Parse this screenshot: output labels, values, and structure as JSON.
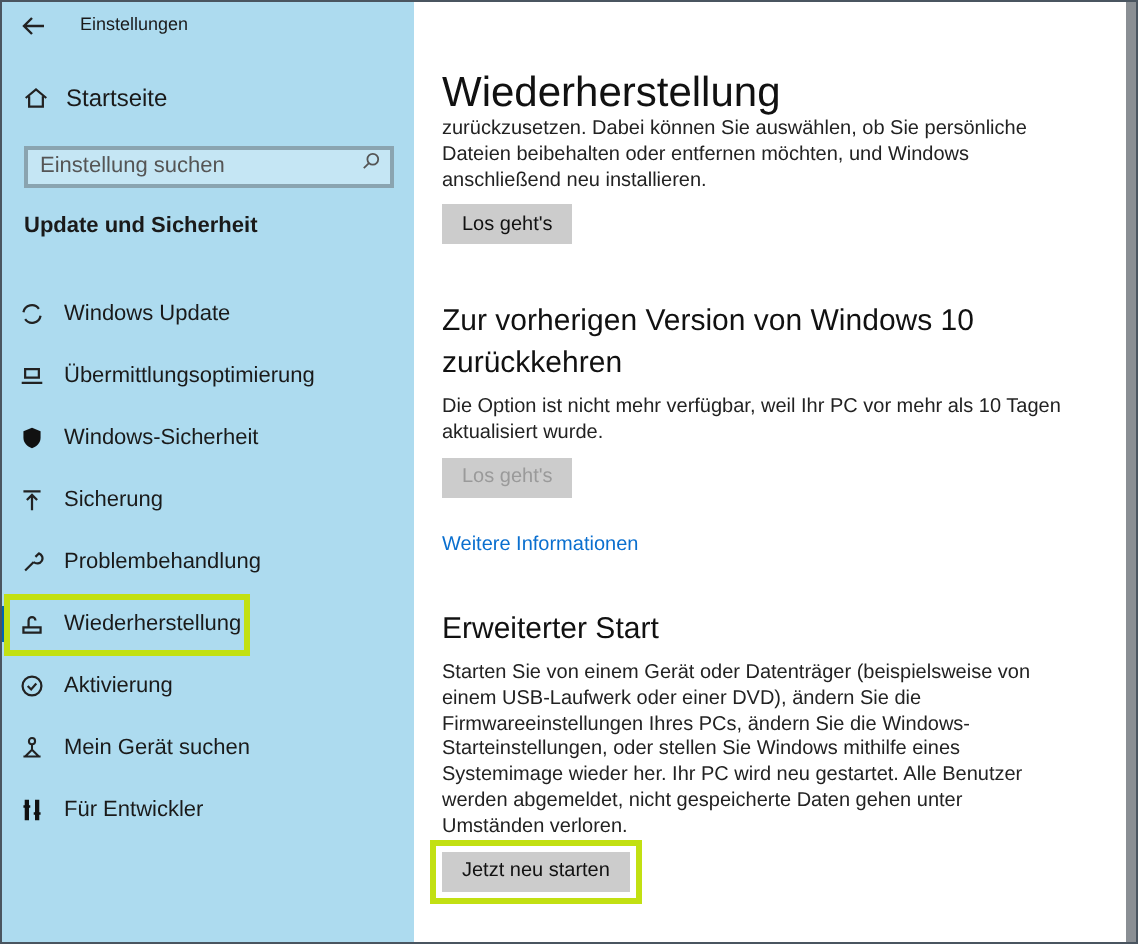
{
  "window": {
    "title": "Einstellungen"
  },
  "sidebar": {
    "home": "Startseite",
    "search": {
      "placeholder": "Einstellung suchen"
    },
    "section": "Update und Sicherheit",
    "items": [
      {
        "label": "Windows Update",
        "selected": false,
        "highlighted": false
      },
      {
        "label": "Übermittlungsoptimierung",
        "selected": false,
        "highlighted": false
      },
      {
        "label": "Windows-Sicherheit",
        "selected": false,
        "highlighted": false
      },
      {
        "label": "Sicherung",
        "selected": false,
        "highlighted": false
      },
      {
        "label": "Problembehandlung",
        "selected": false,
        "highlighted": false
      },
      {
        "label": "Wiederherstellung",
        "selected": true,
        "highlighted": true
      },
      {
        "label": "Aktivierung",
        "selected": false,
        "highlighted": false
      },
      {
        "label": "Mein Gerät suchen",
        "selected": false,
        "highlighted": false
      },
      {
        "label": "Für Entwickler",
        "selected": false,
        "highlighted": false
      }
    ]
  },
  "main": {
    "title": "Wiederherstellung",
    "sections": [
      {
        "text": "zurückzusetzen. Dabei können Sie auswählen, ob Sie persönliche Dateien beibehalten oder entfernen möchten, und Windows anschließend neu installieren.",
        "button": {
          "label": "Los geht's",
          "disabled": false
        }
      },
      {
        "heading": "Zur vorherigen Version von Windows 10 zurückkehren",
        "text": "Die Option ist nicht mehr verfügbar, weil Ihr PC vor mehr als 10 Tagen aktualisiert wurde.",
        "button": {
          "label": "Los geht's",
          "disabled": true
        },
        "link": "Weitere Informationen"
      },
      {
        "heading": "Erweiterter Start",
        "text": "Starten Sie von einem Gerät oder Datenträger (beispielsweise von einem USB-Laufwerk oder einer DVD), ändern Sie die Firmwareeinstellungen Ihres PCs, ändern Sie die Windows-Starteinstellungen, oder stellen Sie Windows mithilfe eines Systemimage wieder her. Ihr PC wird neu gestartet. Alle Benutzer werden abgemeldet, nicht gespeicherte Daten gehen unter Umständen verloren.",
        "button": {
          "label": "Jetzt neu starten",
          "disabled": false,
          "highlighted": true
        }
      }
    ]
  }
}
